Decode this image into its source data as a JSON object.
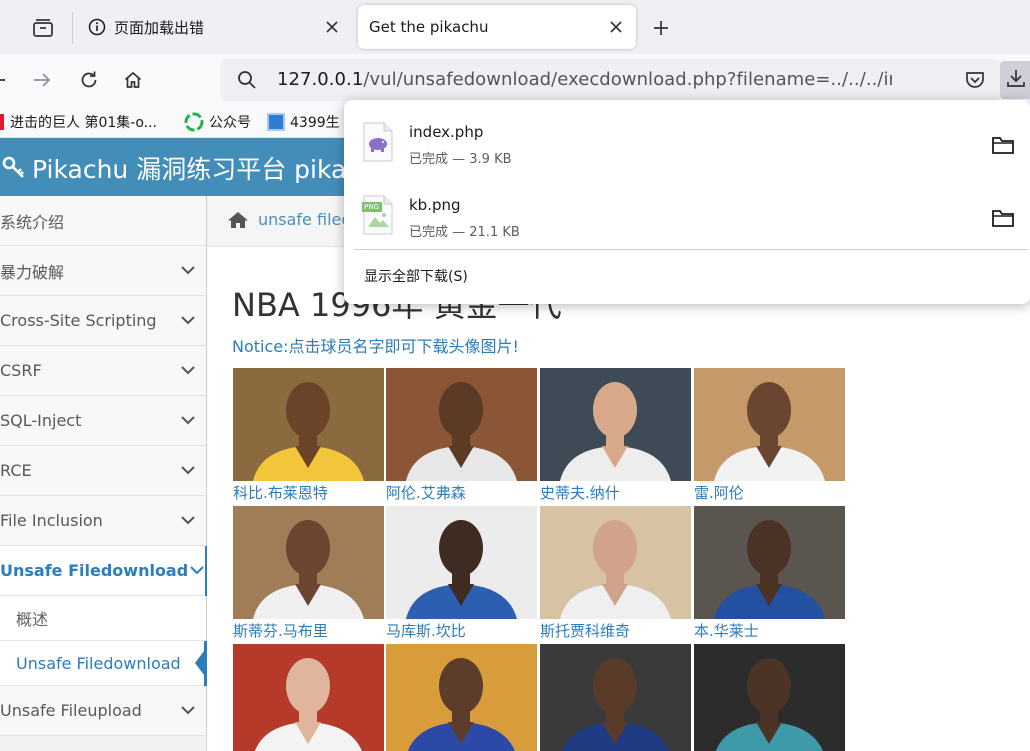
{
  "browser": {
    "tabs": [
      {
        "title": "页面加载出错",
        "icon": "info-circle-icon"
      },
      {
        "title": "Get the pikachu",
        "active": true
      }
    ],
    "url_host": "127.0.0.1",
    "url_path": "/vul/unsafedownload/execdownload.php?filename=../../../index.p",
    "bookmarks": [
      {
        "label": "进击的巨人 第01集-o...",
        "icon": "red-bar-icon"
      },
      {
        "label": "公众号",
        "icon": "wechat-icon"
      },
      {
        "label": "4399生",
        "icon": "4399-icon"
      }
    ]
  },
  "downloads": {
    "items": [
      {
        "name": "index.php",
        "status": "已完成 — 3.9 KB",
        "icon": "php-file-icon"
      },
      {
        "name": "kb.png",
        "status": "已完成 — 21.1 KB",
        "icon": "png-file-icon",
        "icon_text": "PNG"
      }
    ],
    "show_all": "显示全部下载(S)"
  },
  "site": {
    "logo": "Pikachu 漏洞练习平台 pika~",
    "breadcrumb": "unsafe filedownload",
    "title": "NBA 1996年 黄金一代",
    "notice": "Notice:点击球员名字即可下载头像图片!",
    "colors": {
      "header": "#438eb9",
      "link": "#2b7dbc"
    }
  },
  "sidebar": {
    "items": [
      {
        "label": "系统介绍",
        "chevron": false
      },
      {
        "label": "暴力破解",
        "chevron": true
      },
      {
        "label": "Cross-Site Scripting",
        "chevron": true
      },
      {
        "label": "CSRF",
        "chevron": true
      },
      {
        "label": "SQL-Inject",
        "chevron": true
      },
      {
        "label": "RCE",
        "chevron": true
      },
      {
        "label": "File Inclusion",
        "chevron": true
      },
      {
        "label": "Unsafe Filedownload",
        "chevron": true,
        "active": true
      },
      {
        "label": "Unsafe Fileupload",
        "chevron": true
      }
    ],
    "subitems": [
      {
        "label": "概述"
      },
      {
        "label": "Unsafe Filedownload",
        "current": true
      }
    ]
  },
  "players": [
    {
      "name": "科比.布莱恩特",
      "bg": "#8a6a3e",
      "jersey": "#f3c53b",
      "skin": "#6b4328"
    },
    {
      "name": "阿伦.艾弗森",
      "bg": "#8a5636",
      "jersey": "#e8e8e8",
      "skin": "#5b3a26"
    },
    {
      "name": "史蒂夫.纳什",
      "bg": "#3f4a57",
      "jersey": "#ededed",
      "skin": "#d8a88a"
    },
    {
      "name": "雷.阿伦",
      "bg": "#c49a6a",
      "jersey": "#f2f2f2",
      "skin": "#6a4630"
    },
    {
      "name": "斯蒂芬.马布里",
      "bg": "#a07d56",
      "jersey": "#f0f0f0",
      "skin": "#6b4530"
    },
    {
      "name": "马库斯.坎比",
      "bg": "#ececec",
      "jersey": "#2d5fb0",
      "skin": "#3e2b22"
    },
    {
      "name": "斯托贾科维奇",
      "bg": "#d7c2a4",
      "jersey": "#efefef",
      "skin": "#d0a38a"
    },
    {
      "name": "本.华莱士",
      "bg": "#5b5550",
      "jersey": "#2350a0",
      "skin": "#4a3326"
    },
    {
      "name": "",
      "bg": "#b53a2a",
      "jersey": "#f3f3f3",
      "skin": "#e0b59d"
    },
    {
      "name": "",
      "bg": "#d89c3b",
      "jersey": "#2b4aa8",
      "skin": "#5c3d2b"
    },
    {
      "name": "",
      "bg": "#3a3a3a",
      "jersey": "#1f3b82",
      "skin": "#5a3b2a"
    },
    {
      "name": "",
      "bg": "#2c2c2c",
      "jersey": "#3e9aa8",
      "skin": "#4b3325"
    }
  ]
}
